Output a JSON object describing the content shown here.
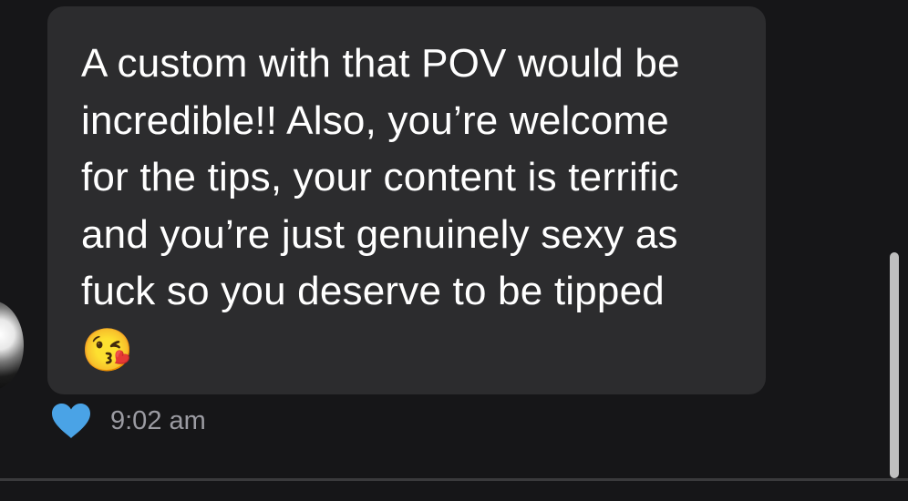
{
  "conversation": {
    "message": {
      "text": "A custom with that POV would be\nincredible!! Also, you’re welcome\nfor the tips, your content is terrific\nand you’re just genuinely sexy as\nfuck so you deserve to be tipped",
      "emoji": "😘",
      "time": "9:02 am",
      "reaction_icon": "heart-icon",
      "reaction_color": "#4aa3e6"
    }
  },
  "colors": {
    "background": "#161618",
    "bubble": "#2c2c2e",
    "text": "#ffffff",
    "timestamp": "#9b9ba2",
    "scrollbar": "#bfbfbf"
  }
}
